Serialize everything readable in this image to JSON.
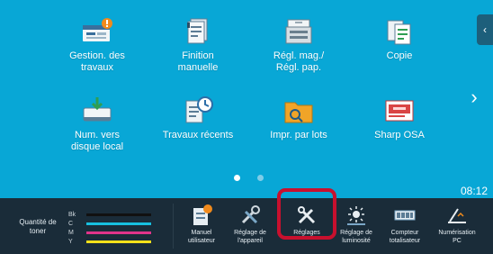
{
  "tiles": [
    {
      "label": "Gestion. des\ntravaux",
      "icon": "job-status-icon"
    },
    {
      "label": "Finition\nmanuelle",
      "icon": "manual-finishing-icon"
    },
    {
      "label": "Régl. mag./\nRégl. pap.",
      "icon": "tray-settings-icon"
    },
    {
      "label": "Copie",
      "icon": "copy-icon"
    },
    {
      "label": "Num. vers\ndisque local",
      "icon": "scan-to-local-drive-icon"
    },
    {
      "label": "Travaux récents",
      "icon": "recent-jobs-icon"
    },
    {
      "label": "Impr. par lots",
      "icon": "batch-print-icon"
    },
    {
      "label": "Sharp OSA",
      "icon": "sharp-osa-icon"
    }
  ],
  "page_dots": {
    "count": 2,
    "active_index": 0
  },
  "clock": "08:12",
  "side_tab_icon": "chevron-left-icon",
  "next_page_icon": "chevron-right-icon",
  "toner": {
    "title": "Quantité de\ntoner",
    "levels": [
      {
        "key": "Bk",
        "color": "#111111",
        "level": 1.0
      },
      {
        "key": "C",
        "color": "#17c0e0",
        "level": 1.0
      },
      {
        "key": "M",
        "color": "#e0348a",
        "level": 1.0
      },
      {
        "key": "Y",
        "color": "#f3e01a",
        "level": 1.0
      }
    ]
  },
  "taskbar": [
    {
      "label": "Manuel\nutilisateur",
      "icon": "user-manual-icon"
    },
    {
      "label": "Réglage de\nl'appareil",
      "icon": "device-settings-icon"
    },
    {
      "label": "Réglages",
      "icon": "settings-tools-icon",
      "highlighted": true
    },
    {
      "label": "Réglage de\nluminosité",
      "icon": "brightness-icon"
    },
    {
      "label": "Compteur\ntotalisateur",
      "icon": "total-counter-icon"
    },
    {
      "label": "Numérisation\nPC",
      "icon": "pc-scan-icon"
    }
  ],
  "colors": {
    "screen_bg": "#08a7d6",
    "taskbar_bg": "#1a2c39",
    "highlight": "#c8102e"
  }
}
